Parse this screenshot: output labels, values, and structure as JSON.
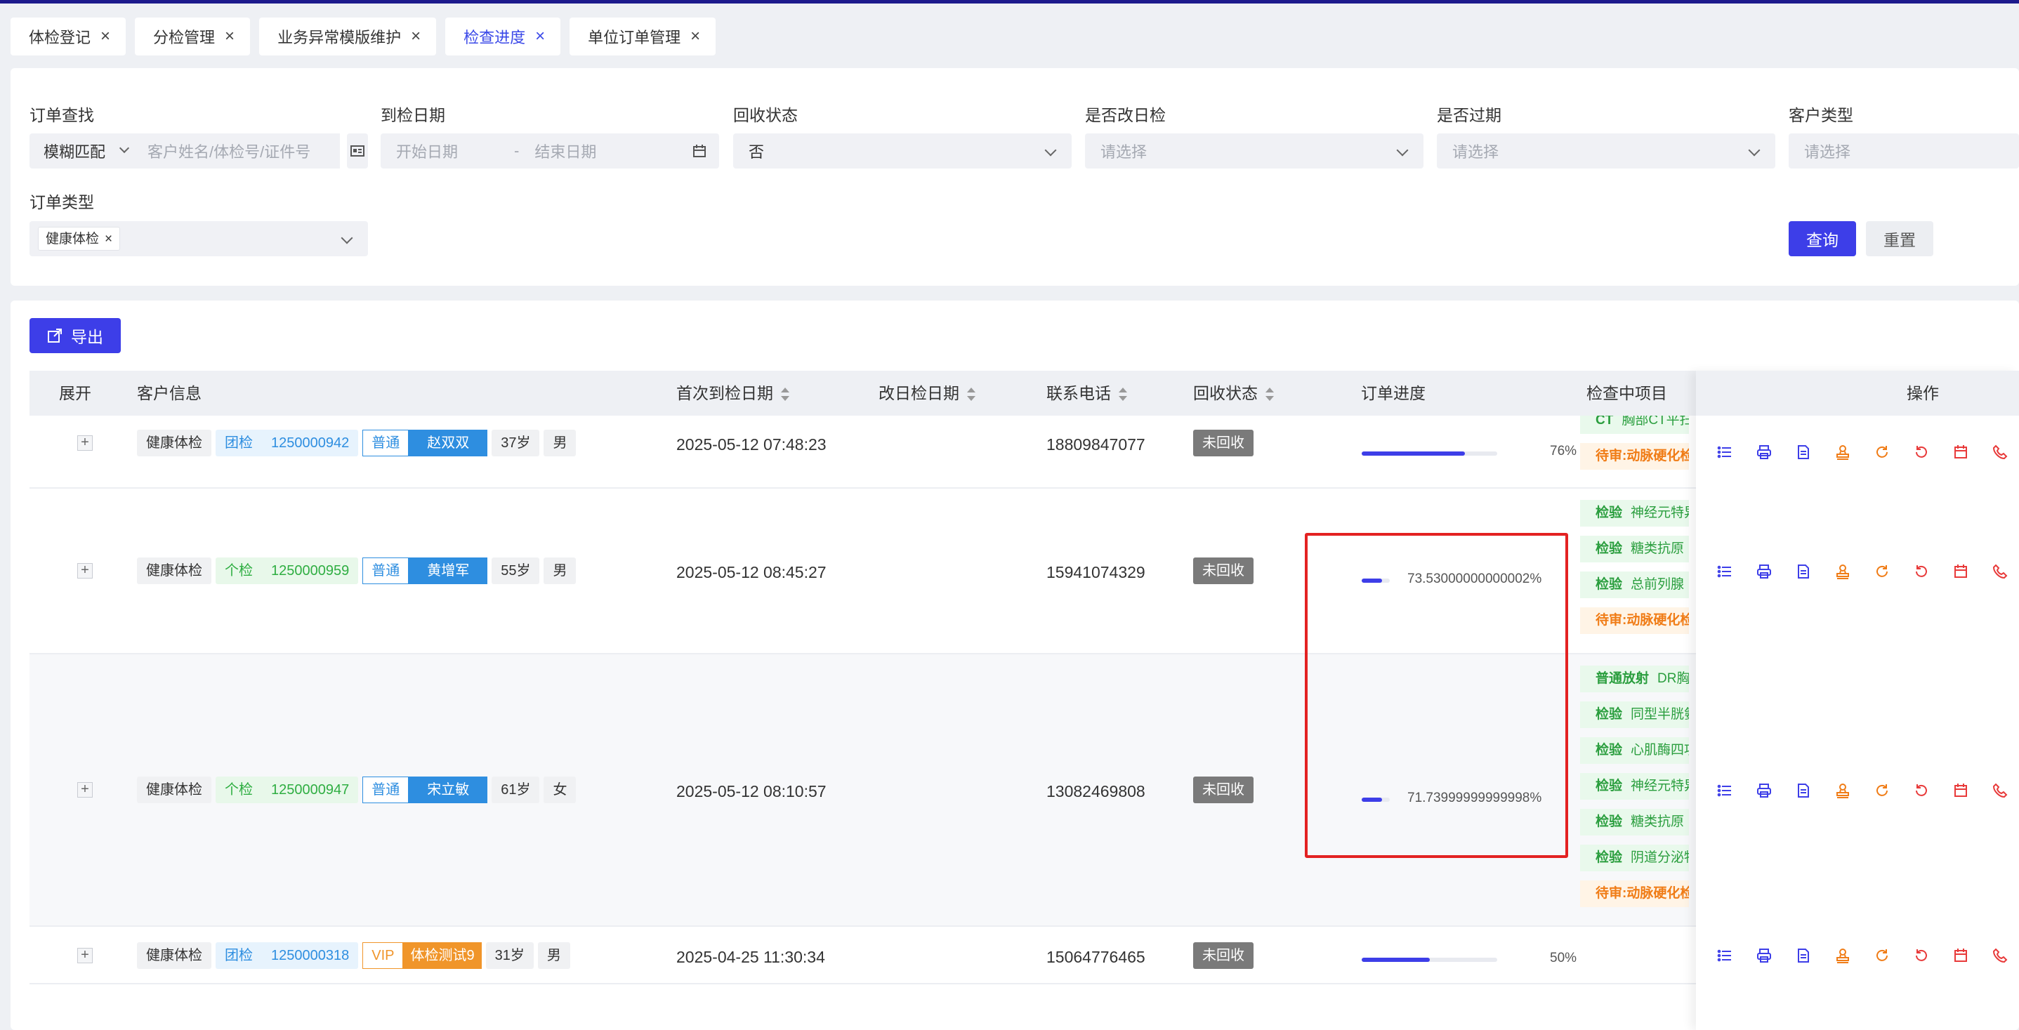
{
  "tabs": [
    {
      "label": "体检登记",
      "active": false
    },
    {
      "label": "分检管理",
      "active": false
    },
    {
      "label": "业务异常模版维护",
      "active": false
    },
    {
      "label": "检查进度",
      "active": true
    },
    {
      "label": "单位订单管理",
      "active": false
    }
  ],
  "filters": {
    "order_search": {
      "label": "订单查找",
      "mode": "模糊匹配",
      "placeholder": "客户姓名/体检号/证件号"
    },
    "arrival_date": {
      "label": "到检日期",
      "start_placeholder": "开始日期",
      "sep": "-",
      "end_placeholder": "结束日期"
    },
    "recycle_status": {
      "label": "回收状态",
      "value": "否"
    },
    "rescheduled": {
      "label": "是否改日检",
      "placeholder": "请选择"
    },
    "expired": {
      "label": "是否过期",
      "placeholder": "请选择"
    },
    "customer_type": {
      "label": "客户类型",
      "placeholder": "请选择"
    },
    "order_type": {
      "label": "订单类型",
      "tag": "健康体检"
    },
    "query_label": "查询",
    "reset_label": "重置"
  },
  "toolbar": {
    "export_label": "导出"
  },
  "columns": {
    "expand": "展开",
    "customer": "客户信息",
    "first_date": "首次到检日期",
    "reschedule_date": "改日检日期",
    "phone": "联系电话",
    "recycle": "回收状态",
    "progress": "订单进度",
    "items": "检查中项目",
    "ops": "操作"
  },
  "rows": [
    {
      "expand": "+",
      "type": "健康体检",
      "group": "团检",
      "group_color": "blue",
      "id": "1250000942",
      "level": "普通",
      "level_color": "blue",
      "name": "赵双双",
      "age": "37岁",
      "gender": "男",
      "first_date": "2025-05-12 07:48:23",
      "phone": "18809847077",
      "status": "未回收",
      "progress": 0.76,
      "progress_text": "76%",
      "items": [
        {
          "kind": "green",
          "k": "CT",
          "v": "胸部CT平扫"
        },
        {
          "kind": "orange",
          "text": "待审:动脉硬化检测"
        }
      ]
    },
    {
      "expand": "+",
      "type": "健康体检",
      "group": "个检",
      "group_color": "green",
      "id": "1250000959",
      "level": "普通",
      "level_color": "blue",
      "name": "黄增军",
      "age": "55岁",
      "gender": "男",
      "first_date": "2025-05-12 08:45:27",
      "phone": "15941074329",
      "status": "未回收",
      "progress": 0.7353,
      "progress_text": "73.53000000000002%",
      "items": [
        {
          "kind": "green",
          "k": "检验",
          "v": "神经元特异性"
        },
        {
          "kind": "green",
          "k": "检验",
          "v": "糖类抗原"
        },
        {
          "kind": "green",
          "k": "检验",
          "v": "总前列腺"
        },
        {
          "kind": "orange",
          "text": "待审:动脉硬化检测"
        }
      ]
    },
    {
      "expand": "+",
      "type": "健康体检",
      "group": "个检",
      "group_color": "green",
      "id": "1250000947",
      "level": "普通",
      "level_color": "blue",
      "name": "宋立敏",
      "age": "61岁",
      "gender": "女",
      "first_date": "2025-05-12 08:10:57",
      "phone": "13082469808",
      "status": "未回收",
      "progress": 0.7174,
      "progress_text": "71.73999999999998%",
      "items": [
        {
          "kind": "green",
          "k": "普通放射",
          "v": "DR胸片"
        },
        {
          "kind": "green",
          "k": "检验",
          "v": "同型半胱氨酸"
        },
        {
          "kind": "green",
          "k": "检验",
          "v": "心肌酶四项"
        },
        {
          "kind": "green",
          "k": "检验",
          "v": "神经元特异性"
        },
        {
          "kind": "green",
          "k": "检验",
          "v": "糖类抗原"
        },
        {
          "kind": "green",
          "k": "检验",
          "v": "阴道分泌物"
        },
        {
          "kind": "orange",
          "text": "待审:动脉硬化检测"
        }
      ]
    },
    {
      "expand": "+",
      "type": "健康体检",
      "group": "团检",
      "group_color": "blue",
      "id": "1250000318",
      "level": "VIP",
      "level_color": "orange",
      "name": "体检测试9",
      "age": "31岁",
      "gender": "男",
      "first_date": "2025-04-25 11:30:34",
      "phone": "15064776465",
      "status": "未回收",
      "progress": 0.5,
      "progress_text": "50%",
      "items": []
    }
  ],
  "op_icons": [
    {
      "name": "list-icon",
      "color": "#3d3ee8"
    },
    {
      "name": "print-icon",
      "color": "#3d3ee8"
    },
    {
      "name": "document-icon",
      "color": "#3d3ee8"
    },
    {
      "name": "stamp-icon",
      "color": "#f07c16"
    },
    {
      "name": "refresh-icon",
      "color": "#f07c16"
    },
    {
      "name": "rollback-icon",
      "color": "#e83a3a"
    },
    {
      "name": "calendar-icon",
      "color": "#e83a3a"
    },
    {
      "name": "phone-icon",
      "color": "#e83a3a"
    }
  ],
  "colors": {
    "primary": "#3d3ee8",
    "highlight": "#e32222"
  }
}
